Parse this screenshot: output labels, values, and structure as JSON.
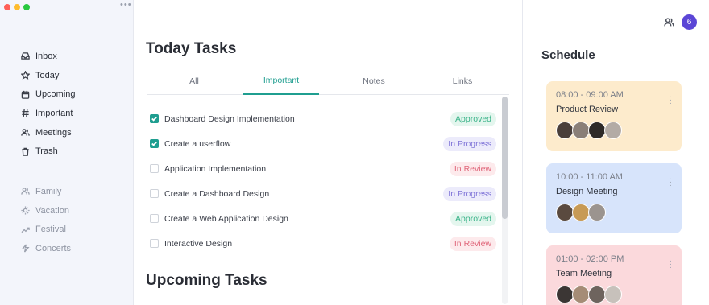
{
  "sidebar": {
    "menu_icon": "more-horizontal-icon",
    "items": [
      {
        "label": "Inbox",
        "icon": "inbox-icon"
      },
      {
        "label": "Today",
        "icon": "star-icon"
      },
      {
        "label": "Upcoming",
        "icon": "calendar-icon"
      },
      {
        "label": "Important",
        "icon": "hash-icon"
      },
      {
        "label": "Meetings",
        "icon": "users-icon"
      },
      {
        "label": "Trash",
        "icon": "trash-icon"
      }
    ],
    "tags": [
      {
        "label": "Family",
        "icon": "users-icon"
      },
      {
        "label": "Vacation",
        "icon": "sun-icon"
      },
      {
        "label": "Festival",
        "icon": "trending-up-icon"
      },
      {
        "label": "Concerts",
        "icon": "zap-icon"
      }
    ]
  },
  "main": {
    "title": "Today Tasks",
    "tabs": [
      {
        "label": "All",
        "active": false
      },
      {
        "label": "Important",
        "active": true
      },
      {
        "label": "Notes",
        "active": false
      },
      {
        "label": "Links",
        "active": false
      }
    ],
    "tasks": [
      {
        "label": "Dashboard Design Implementation",
        "checked": true,
        "status": "Approved"
      },
      {
        "label": "Create a userflow",
        "checked": true,
        "status": "In Progress"
      },
      {
        "label": "Application Implementation",
        "checked": false,
        "status": "In Review"
      },
      {
        "label": "Create a Dashboard Design",
        "checked": false,
        "status": "In Progress"
      },
      {
        "label": "Create a Web Application Design",
        "checked": false,
        "status": "Approved"
      },
      {
        "label": "Interactive Design",
        "checked": false,
        "status": "In Review"
      }
    ],
    "upcoming_title": "Upcoming Tasks"
  },
  "header": {
    "notification_count": "6"
  },
  "schedule": {
    "title": "Schedule",
    "events": [
      {
        "time": "08:00 - 09:00 AM",
        "title": "Product Review",
        "attendees": 4
      },
      {
        "time": "10:00 - 11:00 AM",
        "title": "Design Meeting",
        "attendees": 3
      },
      {
        "time": "01:00 - 02:00 PM",
        "title": "Team Meeting",
        "attendees": 4
      }
    ]
  },
  "colors": {
    "accent": "#1f9e90",
    "approved": "#3cb48a",
    "in_progress": "#7f74d8",
    "in_review": "#e0677b",
    "notification": "#5b46d6"
  }
}
